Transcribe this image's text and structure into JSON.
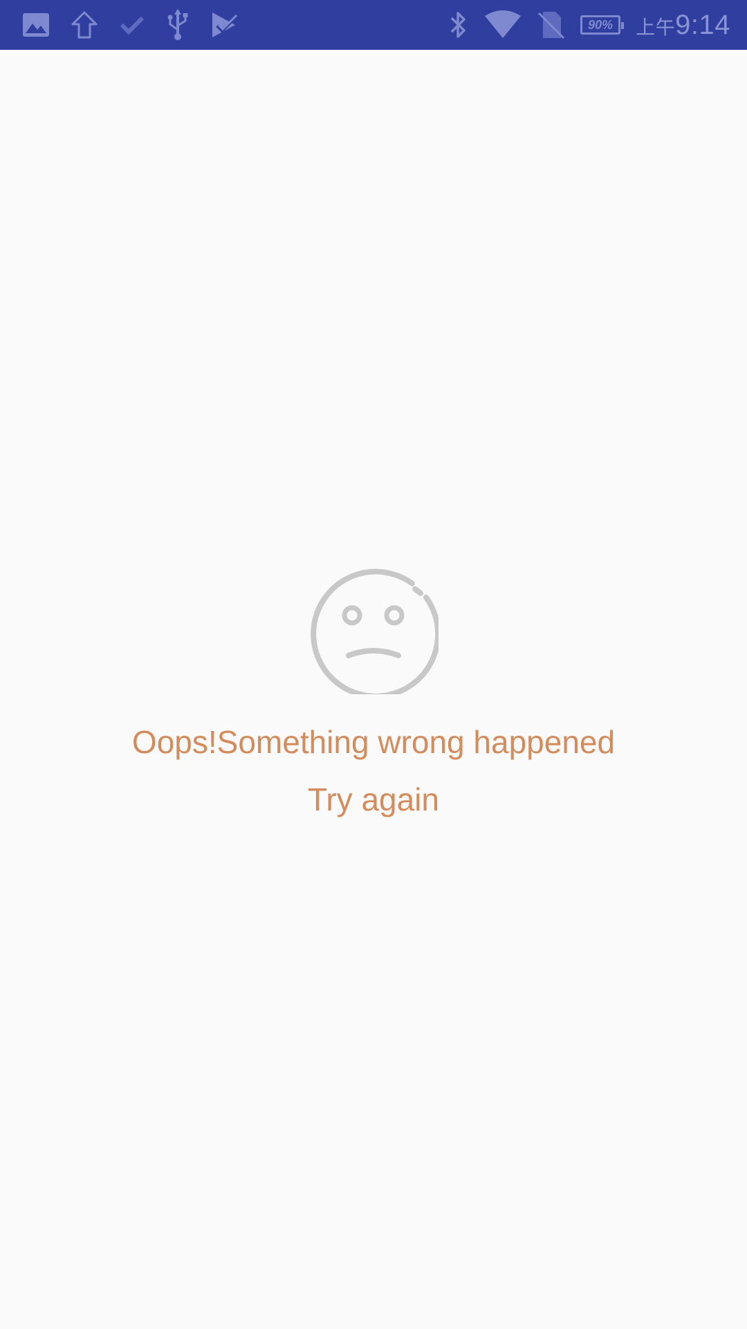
{
  "status_bar": {
    "left_icons": [
      "image-icon",
      "upload-arrow-icon",
      "check-icon",
      "usb-icon",
      "play-store-check-icon"
    ],
    "right_icons": [
      "bluetooth-icon",
      "wifi-icon",
      "no-sim-icon"
    ],
    "battery_text": "90%",
    "time_prefix": "上午",
    "time": "9:14",
    "colors": {
      "background": "#303f9f",
      "icon": "#7f89cf"
    }
  },
  "error_screen": {
    "illustration": "sad-face-icon",
    "message": "Oops!Something wrong happened",
    "retry_label": "Try again",
    "colors": {
      "text": "#d48c5d",
      "illustration": "#c8c8c8",
      "background": "#fafafa"
    }
  }
}
